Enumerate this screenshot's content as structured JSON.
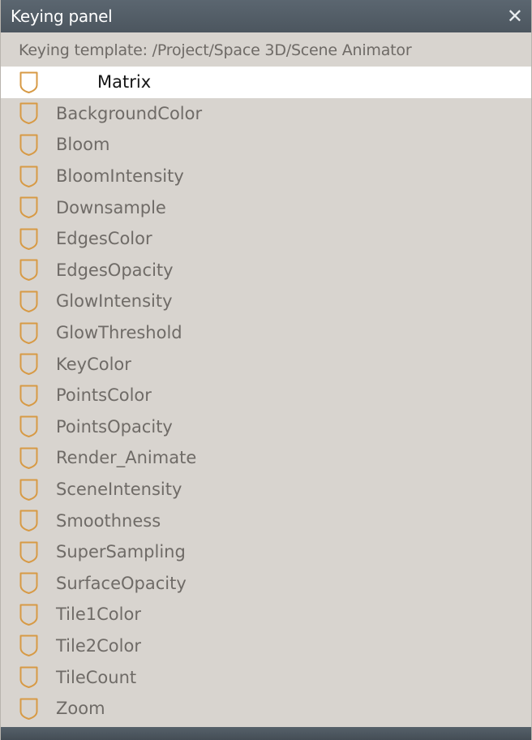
{
  "window": {
    "title": "Keying panel",
    "close_glyph": "✕"
  },
  "template_label": "Keying template: /Project/Space 3D/Scene Animator",
  "items": [
    {
      "label": "Matrix",
      "selected": true
    },
    {
      "label": "BackgroundColor"
    },
    {
      "label": "Bloom"
    },
    {
      "label": "BloomIntensity"
    },
    {
      "label": "Downsample"
    },
    {
      "label": "EdgesColor"
    },
    {
      "label": "EdgesOpacity"
    },
    {
      "label": "GlowIntensity"
    },
    {
      "label": "GlowThreshold"
    },
    {
      "label": "KeyColor"
    },
    {
      "label": "PointsColor"
    },
    {
      "label": "PointsOpacity"
    },
    {
      "label": "Render_Animate"
    },
    {
      "label": "SceneIntensity"
    },
    {
      "label": "Smoothness"
    },
    {
      "label": "SuperSampling"
    },
    {
      "label": "SurfaceOpacity"
    },
    {
      "label": "Tile1Color"
    },
    {
      "label": "Tile2Color"
    },
    {
      "label": "TileCount"
    },
    {
      "label": "Zoom"
    }
  ],
  "icon": "keyframe-shield-icon",
  "colors": {
    "titlebar": "#4f5a63",
    "panel_bg": "#d8d4cf",
    "selected_bg": "#ffffff",
    "icon_stroke": "#d79a45",
    "text": "#6f6b67",
    "selected_text": "#151515"
  }
}
